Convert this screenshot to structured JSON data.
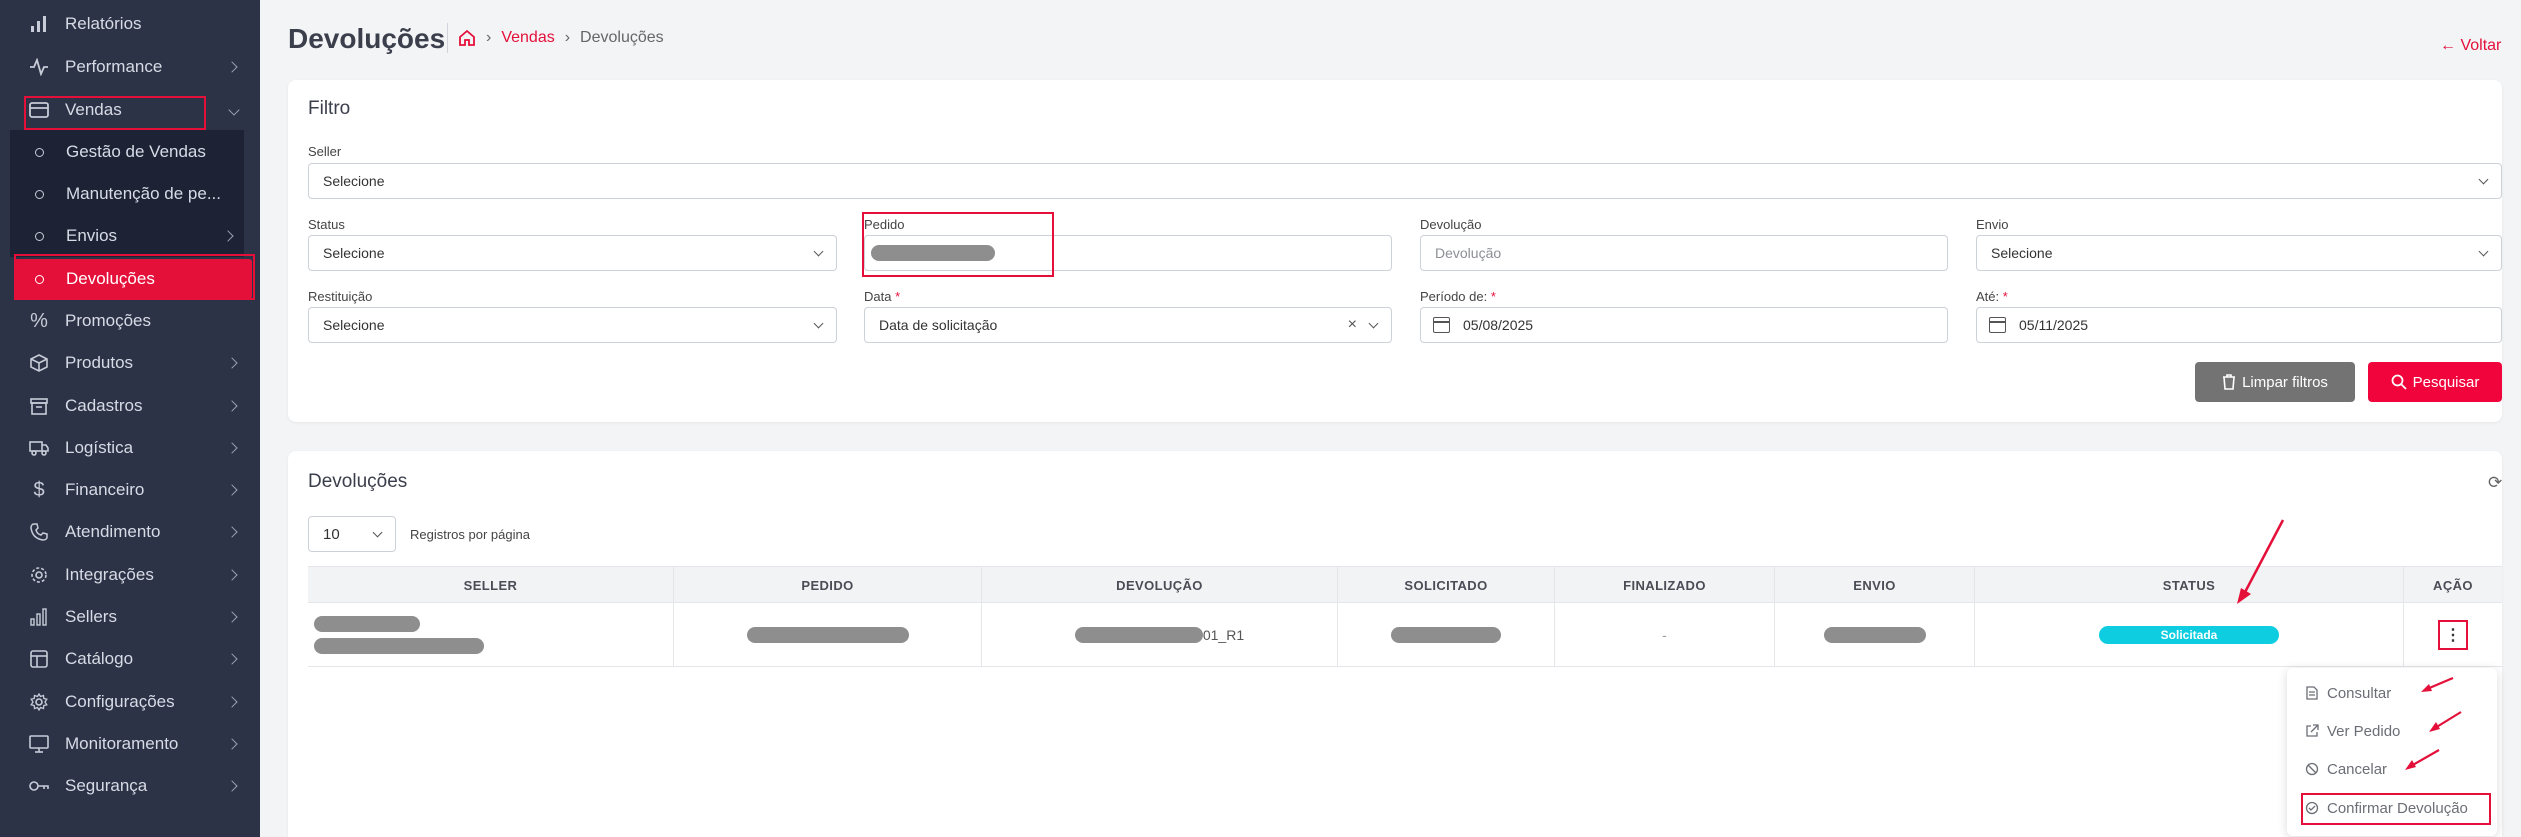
{
  "sidebar": {
    "items": [
      {
        "label": "Relatórios",
        "icon": "bar-chart-icon"
      },
      {
        "label": "Performance",
        "icon": "activity-icon"
      },
      {
        "label": "Vendas",
        "icon": "credit-card-icon"
      },
      {
        "label": "Promoções",
        "icon": "percent-icon"
      },
      {
        "label": "Produtos",
        "icon": "box-icon"
      },
      {
        "label": "Cadastros",
        "icon": "archive-icon"
      },
      {
        "label": "Logística",
        "icon": "truck-icon"
      },
      {
        "label": "Financeiro",
        "icon": "dollar-icon"
      },
      {
        "label": "Atendimento",
        "icon": "phone-icon"
      },
      {
        "label": "Integrações",
        "icon": "settings-icon"
      },
      {
        "label": "Sellers",
        "icon": "bar-chart-icon"
      },
      {
        "label": "Catálogo",
        "icon": "layout-icon"
      },
      {
        "label": "Configurações",
        "icon": "gear-icon"
      },
      {
        "label": "Monitoramento",
        "icon": "monitor-icon"
      },
      {
        "label": "Segurança",
        "icon": "key-icon"
      }
    ],
    "vendas_sub": [
      {
        "label": "Gestão de Vendas"
      },
      {
        "label": "Manutenção de pe..."
      },
      {
        "label": "Envios"
      },
      {
        "label": "Devoluções"
      }
    ]
  },
  "header": {
    "title": "Devoluções",
    "breadcrumb_parent": "Vendas",
    "breadcrumb_current": "Devoluções",
    "back_label": "Voltar"
  },
  "filter": {
    "title": "Filtro",
    "seller_label": "Seller",
    "seller_value": "Selecione",
    "status_label": "Status",
    "status_value": "Selecione",
    "pedido_label": "Pedido",
    "devolucao_label": "Devolução",
    "devolucao_placeholder": "Devolução",
    "envio_label": "Envio",
    "envio_value": "Selecione",
    "restituicao_label": "Restituição",
    "restituicao_value": "Selecione",
    "data_label": "Data",
    "data_value": "Data de solicitação",
    "periodo_label": "Período de:",
    "periodo_value": "05/08/2025",
    "ate_label": "Até:",
    "ate_value": "05/11/2025",
    "required_mark": "*",
    "clear_label": "Limpar filtros",
    "search_label": "Pesquisar"
  },
  "results": {
    "title": "Devoluções",
    "per_page_value": "10",
    "per_page_label": "Registros por página",
    "columns": [
      "SELLER",
      "PEDIDO",
      "DEVOLUÇÃO",
      "SOLICITADO",
      "FINALIZADO",
      "ENVIO",
      "STATUS",
      "AÇÃO"
    ],
    "row": {
      "devolucao_suffix": "01_R1",
      "finalizado": "-",
      "status": "Solicitada"
    },
    "status_color": "#0fcde0"
  },
  "action_menu": {
    "items": [
      "Consultar",
      "Ver Pedido",
      "Cancelar",
      "Confirmar Devolução"
    ]
  },
  "colors": {
    "accent": "#e4103a",
    "sidebar_bg": "#2d3346"
  }
}
